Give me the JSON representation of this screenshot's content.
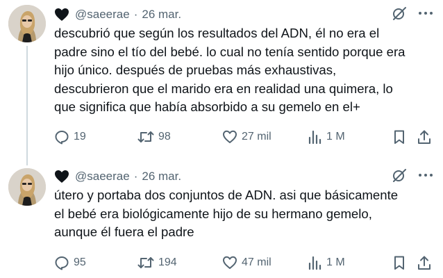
{
  "tweets": [
    {
      "handle": "@saeerae",
      "separator": "·",
      "date": "26 mar.",
      "text": "descubrió que según los resultados del ADN, él no era el\npadre sino el tío del bebé. lo cual no tenía sentido porque era\nhijo único. después de pruebas más exhaustivas,\ndescubrieron que el marido era en realidad una quimera, lo\nque significa que había absorbido a su gemelo en el+",
      "replies": "19",
      "retweets": "98",
      "likes": "27 mil",
      "views": "1 M"
    },
    {
      "handle": "@saeerae",
      "separator": "·",
      "date": "26 mar.",
      "text": "útero y portaba dos conjuntos de ADN. asi que básicamente\nel bebé era biológicamente hijo de su hermano gemelo,\naunque él fuera el padre",
      "replies": "95",
      "retweets": "194",
      "likes": "47 mil",
      "views": "1 M"
    }
  ],
  "icons": {
    "name_heart": "black-heart-icon",
    "grok": "grok-icon",
    "more": "more-icon",
    "reply": "reply-icon",
    "retweet": "retweet-icon",
    "like": "like-icon",
    "views": "views-icon",
    "bookmark": "bookmark-icon",
    "share": "share-icon"
  },
  "colors": {
    "text": "#0f1419",
    "secondary": "#536471",
    "thread_line": "#cfd9de"
  }
}
